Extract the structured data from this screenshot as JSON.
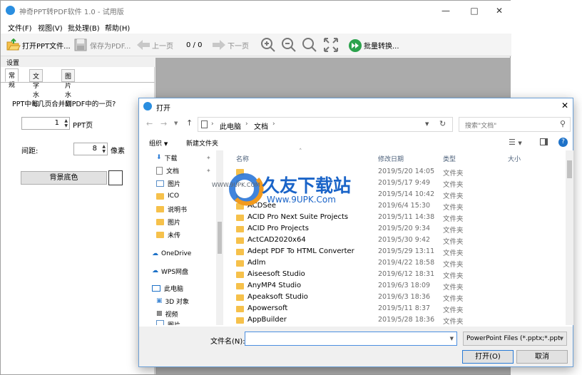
{
  "app": {
    "title": "神奇PPT转PDF软件 1.0 - 试用版",
    "menu": [
      "文件(F)",
      "视图(V)",
      "批处理(B)",
      "帮助(H)"
    ],
    "toolbar": {
      "open": "打开PPT文件...",
      "save": "保存为PDF...",
      "prev": "上一页",
      "page": "0 / 0",
      "next": "下一页",
      "batch": "批量转换..."
    },
    "panel": {
      "header": "设置",
      "tabs": [
        "常规",
        "文字水印",
        "图片水印"
      ],
      "merge_label": "PPT中每几页合并到PDF中的一页?",
      "pages_value": "1",
      "pages_unit": "PPT页",
      "margin_label": "间距:",
      "margin_value": "8",
      "margin_unit": "像素",
      "bgcolor_button": "背景底色"
    }
  },
  "dialog": {
    "title": "打开",
    "breadcrumb": [
      "此电脑",
      "文档"
    ],
    "search_placeholder": "搜索\"文档\"",
    "organize": "组织",
    "new_folder": "新建文件夹",
    "nav": [
      {
        "label": "下载",
        "icon": "download-icon"
      },
      {
        "label": "文档",
        "icon": "document-icon"
      },
      {
        "label": "图片",
        "icon": "picture-icon"
      },
      {
        "label": "ICO",
        "icon": "folder-icon"
      },
      {
        "label": "说明书",
        "icon": "folder-icon"
      },
      {
        "label": "图片",
        "icon": "folder-icon"
      },
      {
        "label": "未传",
        "icon": "folder-icon"
      },
      {
        "label": "OneDrive",
        "icon": "cloud-icon"
      },
      {
        "label": "WPS网盘",
        "icon": "cloud-icon"
      },
      {
        "label": "此电脑",
        "icon": "computer-icon"
      },
      {
        "label": "3D 对象",
        "icon": "cube-icon"
      },
      {
        "label": "视频",
        "icon": "video-icon"
      },
      {
        "label": "图片",
        "icon": "picture-icon"
      }
    ],
    "columns": [
      "名称",
      "修改日期",
      "类型",
      "大小"
    ],
    "rows": [
      {
        "name": "",
        "date": "2019/5/20 14:05",
        "type": "文件夹"
      },
      {
        "name": "",
        "date": "2019/5/17 9:49",
        "type": "文件夹"
      },
      {
        "name": "",
        "date": "2019/5/14 10:42",
        "type": "文件夹"
      },
      {
        "name": "ACDSee",
        "date": "2019/6/4 15:30",
        "type": "文件夹"
      },
      {
        "name": "ACID Pro Next Suite Projects",
        "date": "2019/5/11 14:38",
        "type": "文件夹"
      },
      {
        "name": "ACID Pro Projects",
        "date": "2019/5/20 9:34",
        "type": "文件夹"
      },
      {
        "name": "ActCAD2020x64",
        "date": "2019/5/30 9:42",
        "type": "文件夹"
      },
      {
        "name": "Adept PDF To HTML Converter",
        "date": "2019/5/29 13:11",
        "type": "文件夹"
      },
      {
        "name": "Adlm",
        "date": "2019/4/22 18:58",
        "type": "文件夹"
      },
      {
        "name": "Aiseesoft Studio",
        "date": "2019/6/12 18:31",
        "type": "文件夹"
      },
      {
        "name": "AnyMP4 Studio",
        "date": "2019/6/3 18:09",
        "type": "文件夹"
      },
      {
        "name": "Apeaksoft Studio",
        "date": "2019/6/3 18:36",
        "type": "文件夹"
      },
      {
        "name": "Apowersoft",
        "date": "2019/5/11 8:37",
        "type": "文件夹"
      },
      {
        "name": "AppBuilder",
        "date": "2019/5/28 18:36",
        "type": "文件夹"
      }
    ],
    "filename_label": "文件名(N):",
    "filename_value": "",
    "filter": "PowerPoint Files (*.pptx;*.ppt",
    "open_button": "打开(O)",
    "cancel_button": "取消"
  },
  "watermark": {
    "brand": "久友下载站",
    "url_left": "WWW.9UPK.COM",
    "url_right": "Www.9UPK.Com"
  }
}
